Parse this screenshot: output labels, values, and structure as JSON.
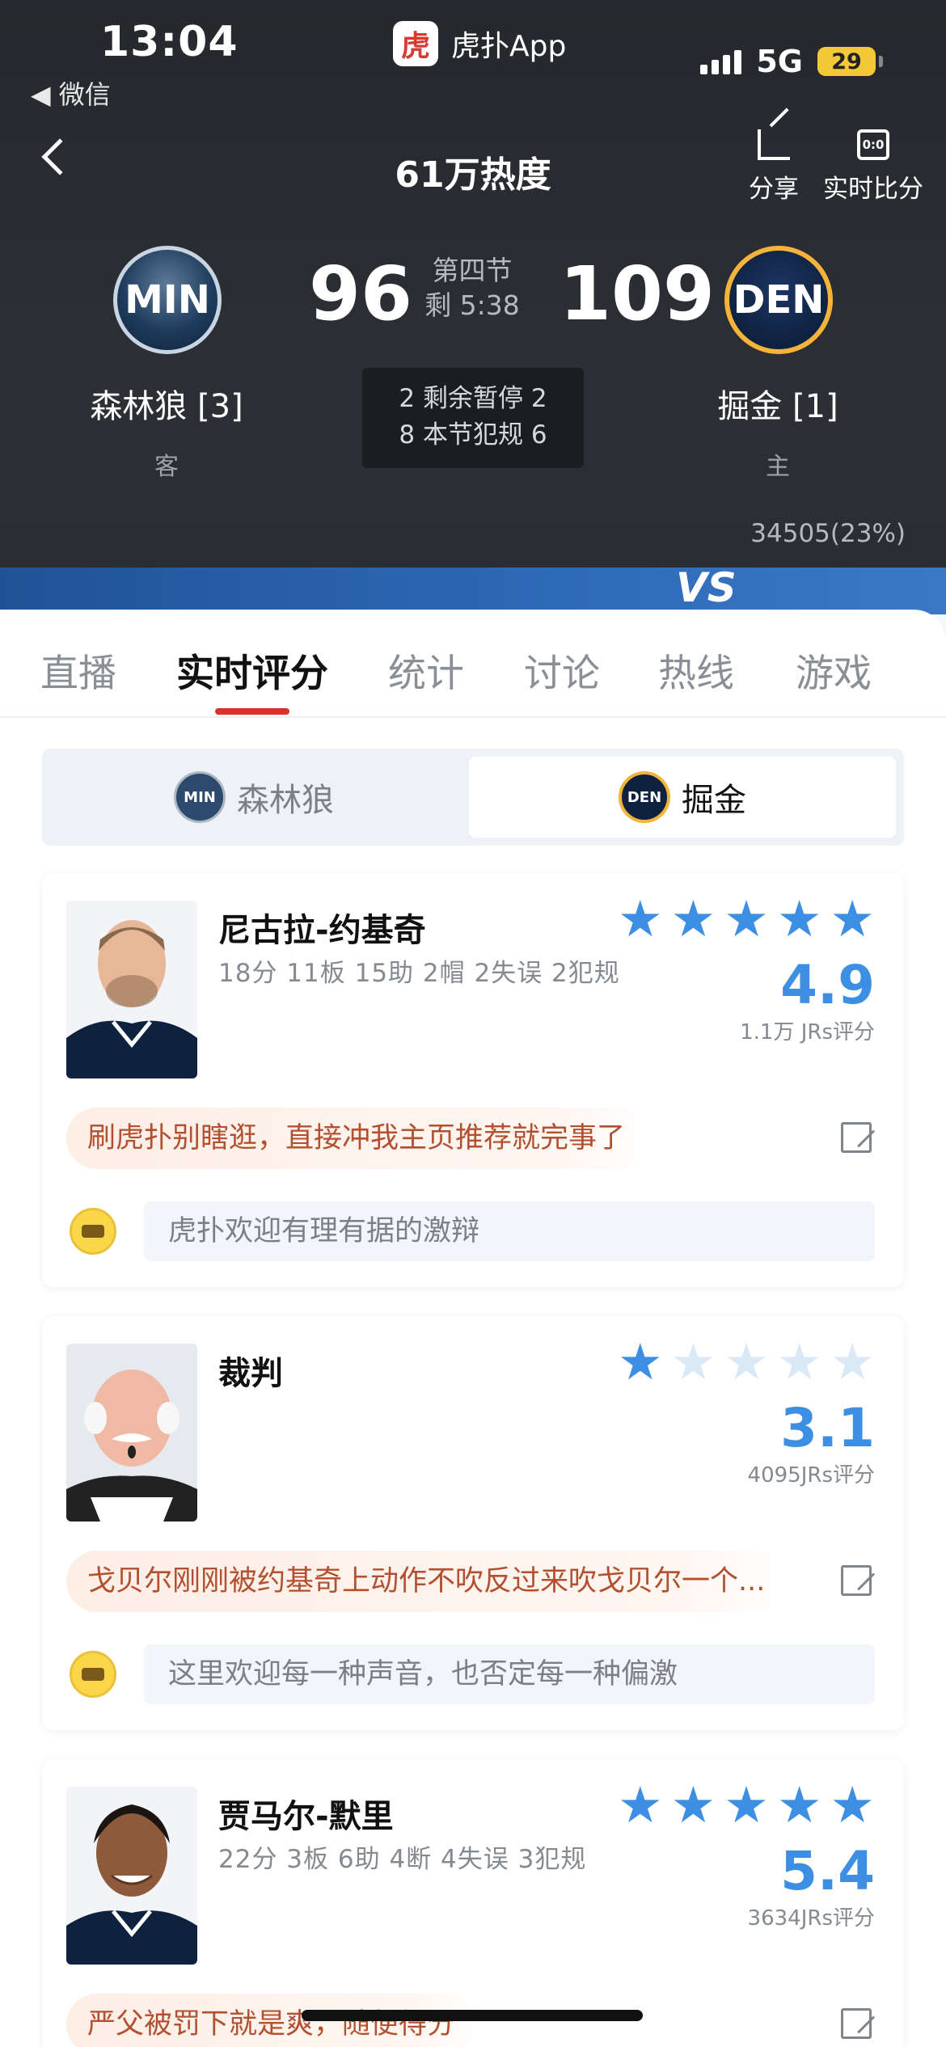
{
  "status_bar": {
    "time": "13:04",
    "back_app": "◀ 微信",
    "app_name": "虎扑App",
    "network": "5G",
    "battery": "29"
  },
  "header": {
    "heat": "61万热度",
    "actions": [
      {
        "label": "分享",
        "icon": "share-icon"
      },
      {
        "label": "实时比分",
        "icon": "live-score-icon"
      }
    ]
  },
  "game": {
    "away": {
      "abbr": "MIN",
      "name": "森林狼 [3]",
      "role": "客",
      "score": "96"
    },
    "home": {
      "abbr": "DEN",
      "name": "掘金 [1]",
      "role": "主",
      "score": "109"
    },
    "period": "第四节",
    "clock": "剩 5:38",
    "timeouts": "2 剩余暂停 2",
    "fouls": "8 本节犯规 6",
    "attendance": "34505(23%)",
    "vs": "VS"
  },
  "tabs": [
    "直播",
    "实时评分",
    "统计",
    "讨论",
    "热线",
    "游戏"
  ],
  "active_tab": "实时评分",
  "team_switch": [
    {
      "label": "森林狼",
      "logo": "MIN",
      "active": false
    },
    {
      "label": "掘金",
      "logo": "DEN",
      "active": true
    }
  ],
  "players": [
    {
      "name": "尼古拉-约基奇",
      "stats": "18分 11板 15助 2帽 2失误 2犯规",
      "stars": 5,
      "rating": "4.9",
      "votes": "1.1万 JRs评分",
      "hot_comment": "刷虎扑别瞎逛，直接冲我主页推荐就完事了",
      "comment_placeholder": "虎扑欢迎有理有据的激辩"
    },
    {
      "name": "裁判",
      "stats": "",
      "stars": 1,
      "rating": "3.1",
      "votes": "4095JRs评分",
      "hot_comment": "戈贝尔刚刚被约基奇上动作不吹反过来吹戈贝尔一个...",
      "comment_placeholder": "这里欢迎每一种声音，也否定每一种偏激"
    },
    {
      "name": "贾马尔-默里",
      "stats": "22分 3板 6助 4断 4失误 3犯规",
      "stars": 5,
      "rating": "5.4",
      "votes": "3634JRs评分",
      "hot_comment": "严父被罚下就是爽，随便得分",
      "comment_placeholder": ""
    }
  ],
  "colors": {
    "accent_red": "#d9312b",
    "star_blue": "#3d8fe3",
    "header_bg": "#2a2d31",
    "den_gold": "#f6b33a"
  }
}
